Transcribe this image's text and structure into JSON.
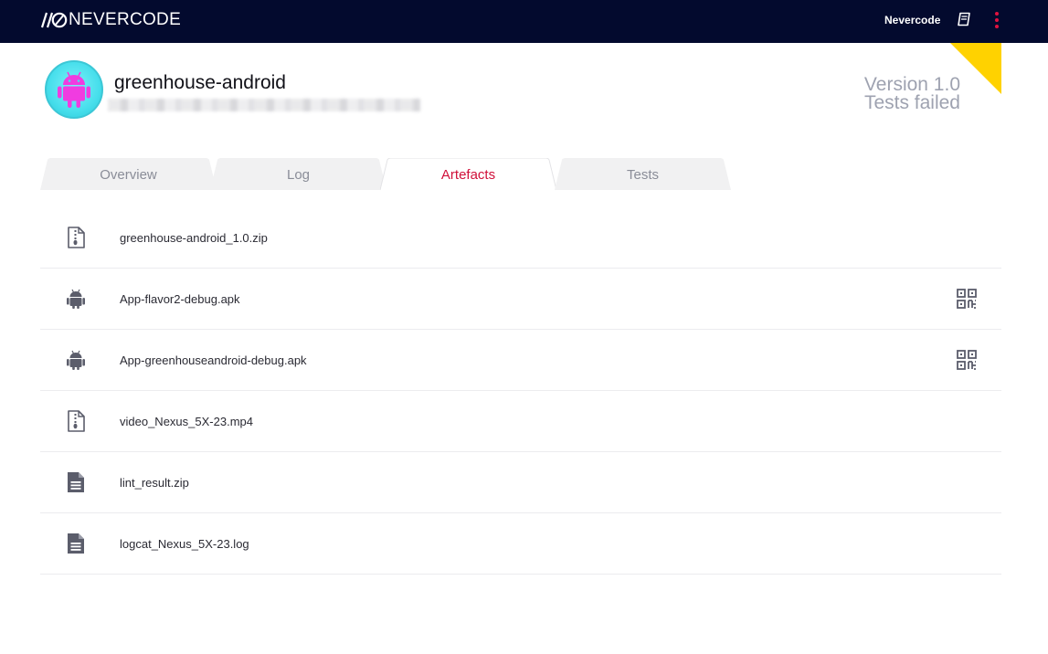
{
  "app": {
    "brand": "NEVERCODE",
    "user": "Nevercode"
  },
  "project": {
    "name": "greenhouse-android",
    "version": "Version 1.0",
    "status": "Tests failed"
  },
  "colors": {
    "topbar": "#030a2e",
    "accent": "#d0103a",
    "flag": "#ffd200",
    "avatar": "#48dfec",
    "android": "#f03ce0"
  },
  "tabs": [
    {
      "label": "Overview",
      "active": false
    },
    {
      "label": "Log",
      "active": false
    },
    {
      "label": "Artefacts",
      "active": true
    },
    {
      "label": "Tests",
      "active": false
    }
  ],
  "artefacts": [
    {
      "name": "greenhouse-android_1.0.zip",
      "icon": "zip-file-icon",
      "qr": false
    },
    {
      "name": "App-flavor2-debug.apk",
      "icon": "android-icon",
      "qr": true
    },
    {
      "name": "App-greenhouseandroid-debug.apk",
      "icon": "android-icon",
      "qr": true
    },
    {
      "name": "video_Nexus_5X-23.mp4",
      "icon": "zip-file-icon",
      "qr": false
    },
    {
      "name": "lint_result.zip",
      "icon": "document-icon",
      "qr": false
    },
    {
      "name": "logcat_Nexus_5X-23.log",
      "icon": "document-icon",
      "qr": false
    }
  ]
}
